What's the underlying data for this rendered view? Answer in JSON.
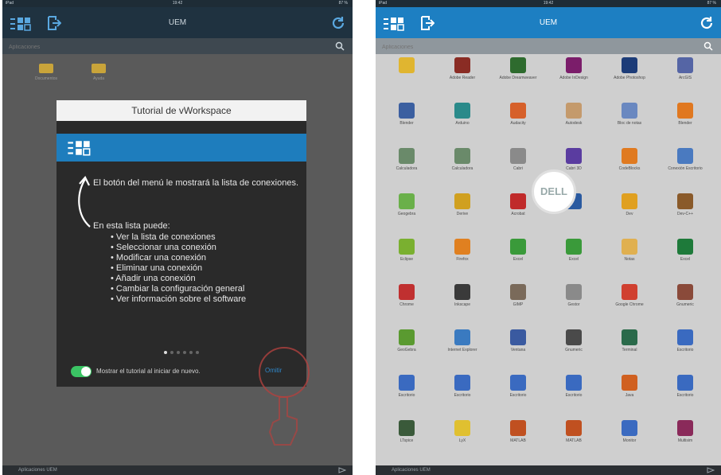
{
  "left": {
    "status": {
      "left": "iPad",
      "center": "19:42",
      "right": "87 %"
    },
    "title": "UEM",
    "search_placeholder": "Aplicaciones",
    "folders": [
      {
        "label": "Documentos"
      },
      {
        "label": "Ayuda"
      }
    ],
    "tutorial": {
      "title": "Tutorial de vWorkspace",
      "intro": "El botón del menú le mostrará la lista de conexiones.",
      "list_title": "En esta lista puede:",
      "items": [
        "• Ver la lista de conexiones",
        "• Seleccionar una conexión",
        "• Modificar una conexión",
        "• Eliminar una conexión",
        "• Añadir una conexión",
        "• Cambiar la configuración general",
        "• Ver información sobre el software"
      ],
      "page_total": 6,
      "page_current": 1,
      "toggle_label": "Mostrar el tutorial al iniciar de nuevo.",
      "toggle_on": true,
      "done_label": "Omitir"
    },
    "bottom": "Aplicaciones UEM"
  },
  "right": {
    "status": {
      "left": "iPad",
      "center": "19:42",
      "right": "87 %"
    },
    "title": "UEM",
    "search_placeholder": "Aplicaciones",
    "dell_logo": "DELL",
    "apps": [
      {
        "label": "",
        "color": "#e0b530",
        "icon": "back-arrow-icon"
      },
      {
        "label": "Adobe Reader",
        "color": "#8a2c24",
        "icon": "app-icon"
      },
      {
        "label": "Adobe Dreamweaver",
        "color": "#2e6b2e",
        "icon": "app-icon"
      },
      {
        "label": "Adobe InDesign",
        "color": "#7b1d6a",
        "icon": "app-icon"
      },
      {
        "label": "Adobe Photoshop",
        "color": "#1d3c78",
        "icon": "app-icon"
      },
      {
        "label": "ArcGIS",
        "color": "#5565a5",
        "icon": "app-icon"
      },
      {
        "label": "Blender",
        "color": "#3b5fa0",
        "icon": "app-icon"
      },
      {
        "label": "Arduino",
        "color": "#2a8a8a",
        "icon": "app-icon"
      },
      {
        "label": "Audacity",
        "color": "#d6602a",
        "icon": "app-icon"
      },
      {
        "label": "Autodesk",
        "color": "#c49a6c",
        "icon": "app-icon"
      },
      {
        "label": "Bloc de notas",
        "color": "#6a88c0",
        "icon": "app-icon"
      },
      {
        "label": "Blender",
        "color": "#e07820",
        "icon": "app-icon"
      },
      {
        "label": "Calculadora",
        "color": "#6a8a6a",
        "icon": "app-icon"
      },
      {
        "label": "Calculadora",
        "color": "#6a8a6a",
        "icon": "app-icon"
      },
      {
        "label": "Cabri",
        "color": "#8a8a8a",
        "icon": "app-icon"
      },
      {
        "label": "Cabri 3D",
        "color": "#5a3ca0",
        "icon": "app-icon"
      },
      {
        "label": "CodeBlocks",
        "color": "#e07a20",
        "icon": "app-icon"
      },
      {
        "label": "Conexión Escritorio",
        "color": "#4a7ac0",
        "icon": "app-icon"
      },
      {
        "label": "Geogebra",
        "color": "#6ab04a",
        "icon": "app-icon"
      },
      {
        "label": "Derive",
        "color": "#d0a020",
        "icon": "app-icon"
      },
      {
        "label": "Acrobat",
        "color": "#c02a2a",
        "icon": "app-icon"
      },
      {
        "label": "",
        "color": "#2a5aa0",
        "icon": "app-icon"
      },
      {
        "label": "Dev",
        "color": "#e0a020",
        "icon": "app-icon"
      },
      {
        "label": "Dev-C++",
        "color": "#8a5a2a",
        "icon": "app-icon"
      },
      {
        "label": "Eclipse",
        "color": "#7ab030",
        "icon": "app-icon"
      },
      {
        "label": "Firefox",
        "color": "#e08020",
        "icon": "app-icon"
      },
      {
        "label": "Excel",
        "color": "#3a9a3a",
        "icon": "app-icon"
      },
      {
        "label": "Excel",
        "color": "#3a9a3a",
        "icon": "app-icon"
      },
      {
        "label": "Notas",
        "color": "#e0b050",
        "icon": "app-icon"
      },
      {
        "label": "Excel",
        "color": "#1e7a3a",
        "icon": "app-icon"
      },
      {
        "label": "Chrome",
        "color": "#c03030",
        "icon": "app-icon"
      },
      {
        "label": "Inkscape",
        "color": "#3a3a3a",
        "icon": "app-icon"
      },
      {
        "label": "GIMP",
        "color": "#7a6a5a",
        "icon": "app-icon"
      },
      {
        "label": "Gestor",
        "color": "#8a8a8a",
        "icon": "app-icon"
      },
      {
        "label": "Google Chrome",
        "color": "#d04030",
        "icon": "app-icon"
      },
      {
        "label": "Gnumeric",
        "color": "#8a4a3a",
        "icon": "app-icon"
      },
      {
        "label": "GeoGebra",
        "color": "#5a9a30",
        "icon": "app-icon"
      },
      {
        "label": "Internet Explorer",
        "color": "#3a7ac0",
        "icon": "app-icon"
      },
      {
        "label": "Ventana",
        "color": "#3a5aa0",
        "icon": "app-icon"
      },
      {
        "label": "Gnumeric",
        "color": "#4a4a4a",
        "icon": "app-icon"
      },
      {
        "label": "Terminal",
        "color": "#2a6a4a",
        "icon": "app-icon"
      },
      {
        "label": "Escritorio",
        "color": "#3a6ac0",
        "icon": "app-icon"
      },
      {
        "label": "Escritorio",
        "color": "#3a6ac0",
        "icon": "app-icon"
      },
      {
        "label": "Escritorio",
        "color": "#3a6ac0",
        "icon": "app-icon"
      },
      {
        "label": "Escritorio",
        "color": "#3a6ac0",
        "icon": "app-icon"
      },
      {
        "label": "Escritorio",
        "color": "#3a6ac0",
        "icon": "app-icon"
      },
      {
        "label": "Java",
        "color": "#d06020",
        "icon": "app-icon"
      },
      {
        "label": "Escritorio",
        "color": "#3a6ac0",
        "icon": "app-icon"
      },
      {
        "label": "LTspice",
        "color": "#3a5a3a",
        "icon": "app-icon"
      },
      {
        "label": "LyX",
        "color": "#e0c030",
        "icon": "app-icon"
      },
      {
        "label": "MATLAB",
        "color": "#c05020",
        "icon": "app-icon"
      },
      {
        "label": "MATLAB",
        "color": "#c05020",
        "icon": "app-icon"
      },
      {
        "label": "Monitor",
        "color": "#3a6ac0",
        "icon": "app-icon"
      },
      {
        "label": "Multisim",
        "color": "#8a2a5a",
        "icon": "app-icon"
      }
    ],
    "bottom": "Aplicaciones UEM"
  }
}
